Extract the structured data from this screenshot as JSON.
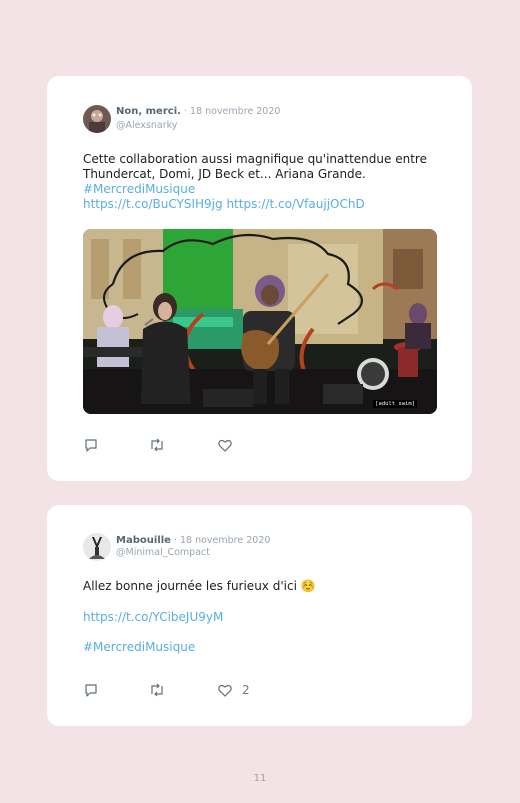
{
  "tweets": [
    {
      "author": "Non, merci.",
      "date": " · 18 novembre 2020",
      "handle": "@Alexsnarky",
      "text_line1": "Cette collaboration aussi magnifique qu'inattendue entre",
      "text_line2": "Thundercat, Domi, JD Beck et... Ariana Grande.",
      "hashtag": "#MercrediMusique",
      "link1": "https://t.co/BuCYSIH9jg",
      "link2": "https://t.co/VfaujjOChD",
      "media_caption": "[adult swim]",
      "media_description": "video still: singer with microphone and bassist on stage with drawn smoke effects"
    },
    {
      "author": "Mabouille",
      "date": " · 18 novembre 2020",
      "handle": "@Minimal_Compact",
      "text": "Allez bonne journée les furieux d'ici ☺️",
      "link": "https://t.co/YCibeJU9yM",
      "hashtag": "#MercrediMusique",
      "like_count": "2"
    }
  ],
  "icons": {
    "reply": "reply-icon",
    "retweet": "retweet-icon",
    "like": "heart-icon"
  },
  "colors": {
    "background": "#f3e2e6",
    "link": "#59aee3",
    "meta": "#9aa6b1"
  },
  "page_number": "11"
}
